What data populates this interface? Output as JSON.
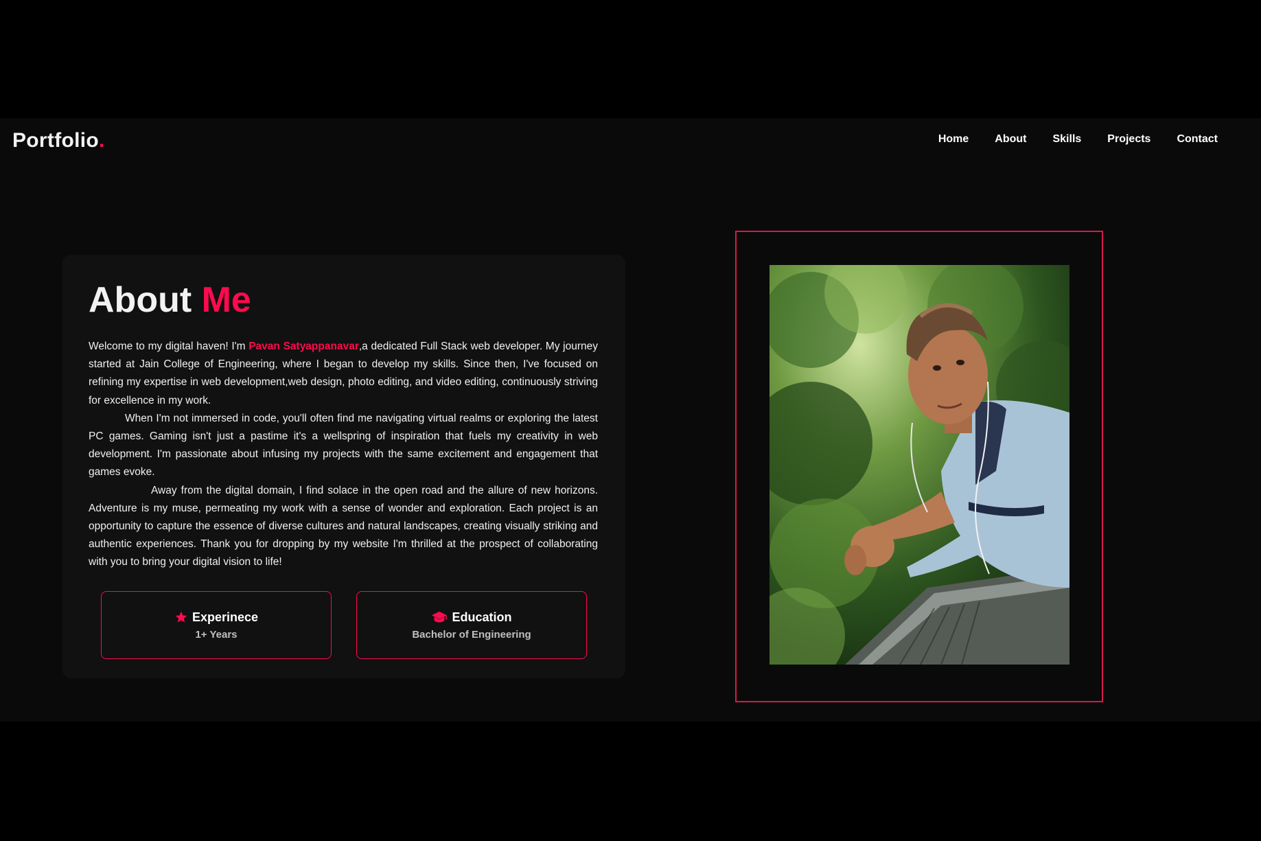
{
  "brand": {
    "name": "Portfolio",
    "dot": "."
  },
  "nav": {
    "items": [
      {
        "label": "Home"
      },
      {
        "label": "About"
      },
      {
        "label": "Skills"
      },
      {
        "label": "Projects"
      },
      {
        "label": "Contact"
      }
    ]
  },
  "about": {
    "title_main": "About ",
    "title_accent": "Me",
    "p1_a": "Welcome to my digital haven! I'm ",
    "p1_name": "Pavan Satyappanavar",
    "p1_b": ",a dedicated Full Stack web developer. My journey started at Jain College of Engineering, where I began to develop my skills. Since then, I've focused on refining my expertise in web development,web design, photo editing, and video editing, continuously striving for excellence in my work.",
    "p2": "When I'm not immersed in code, you'll often find me navigating virtual realms or exploring the latest PC games. Gaming isn't just a pastime it's a wellspring of inspiration that fuels my creativity in web development. I'm passionate about infusing my projects with the same excitement and engagement that games evoke.",
    "p3": "Away from the digital domain, I find solace in the open road and the allure of new horizons. Adventure is my muse, permeating my work with a sense of wonder and exploration. Each project is an opportunity to capture the essence of diverse cultures and natural landscapes, creating visually striking and authentic experiences. Thank you for dropping by my website I'm thrilled at the prospect of collaborating with you to bring your digital vision to life!"
  },
  "cards": {
    "experience": {
      "title": "Experinece",
      "value": "1+ Years",
      "icon": "star-icon"
    },
    "education": {
      "title": "Education",
      "value": "Bachelor of Engineering",
      "icon": "graduation-cap-icon"
    }
  },
  "photo": {
    "description": "profile-photo"
  },
  "colors": {
    "accent": "#ff0a4e",
    "background": "#0a0a0a",
    "card": "#111111"
  }
}
